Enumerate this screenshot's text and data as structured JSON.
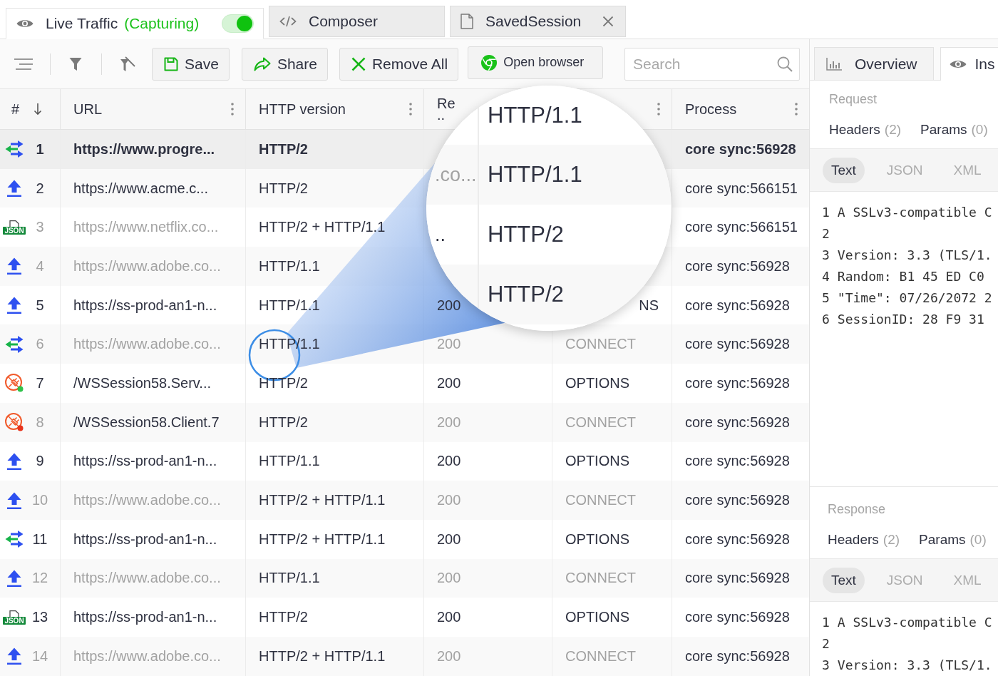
{
  "tabs": [
    {
      "kind": "live",
      "label": "Live Traffic",
      "status": "(Capturing)",
      "capturing": true,
      "closable": false,
      "selected": true
    },
    {
      "kind": "composer",
      "label": "Composer",
      "closable": false,
      "selected": false
    },
    {
      "kind": "session",
      "label": "SavedSession",
      "closable": true,
      "selected": false
    }
  ],
  "toolbar": {
    "buttons": [
      {
        "kind": "save",
        "label": "Save"
      },
      {
        "kind": "share",
        "label": "Share"
      },
      {
        "kind": "remove",
        "label": "Remove All"
      },
      {
        "kind": "browser",
        "label": "Open browser"
      }
    ],
    "search": {
      "placeholder": "Search"
    }
  },
  "table": {
    "columns": [
      {
        "label": "#",
        "sorted": true,
        "menu": false
      },
      {
        "label": "URL",
        "sorted": false,
        "menu": true
      },
      {
        "label": "HTTP version",
        "sorted": false,
        "menu": true
      },
      {
        "label": "Re..",
        "sorted": false,
        "menu": false
      },
      {
        "sorted": false,
        "menu": true
      },
      {
        "label": "Process",
        "sorted": false,
        "menu": true
      }
    ],
    "rows": [
      {
        "kind": "two-way",
        "number": "1",
        "url": "https://www.progre...",
        "version": "HTTP/2",
        "process": "core sync:56928",
        "muted": false,
        "url_muted": false,
        "selected": true
      },
      {
        "kind": "upload",
        "number": "2",
        "url": "https://www.acme.c...",
        "version": "HTTP/2",
        "process": "core sync:566151",
        "muted": false,
        "url_muted": false,
        "selected": false
      },
      {
        "kind": "json",
        "badge": "JSON",
        "number": "3",
        "url": "https://www.netflix.co...",
        "version": "HTTP/2 + HTTP/1.1",
        "process": "core sync:566151",
        "muted": true,
        "url_muted": true,
        "selected": false
      },
      {
        "kind": "upload",
        "number": "4",
        "url": "https://www.adobe.co...",
        "version": "HTTP/1.1",
        "process": "core sync:56928",
        "muted": true,
        "url_muted": true,
        "selected": false
      },
      {
        "kind": "upload",
        "number": "5",
        "url": "https://ss-prod-an1-n...",
        "version": "HTTP/1.1",
        "result": "200",
        "method": "NS",
        "method_cut": true,
        "process": "core sync:56928",
        "muted": false,
        "url_muted": false,
        "selected": false
      },
      {
        "kind": "two-way",
        "number": "6",
        "url": "https://www.adobe.co...",
        "version": "HTTP/1.1",
        "result": "200",
        "method": "CONNECT",
        "process": "core sync:56928",
        "muted": true,
        "url_muted": true,
        "selected": false
      },
      {
        "kind": "plug",
        "color": "#2ec24a",
        "number": "7",
        "url": "/WSSession58.Serv...",
        "version": "HTTP/2",
        "result": "200",
        "method": "OPTIONS",
        "process": "core sync:56928",
        "muted": false,
        "url_muted": false,
        "selected": false
      },
      {
        "kind": "plug",
        "color": "#e8341c",
        "number": "8",
        "url": "/WSSession58.Client.7",
        "version": "HTTP/2",
        "result": "200",
        "method": "CONNECT",
        "process": "core sync:56928",
        "muted": true,
        "url_muted": false,
        "selected": false
      },
      {
        "kind": "upload",
        "number": "9",
        "url": "https://ss-prod-an1-n...",
        "version": "HTTP/1.1",
        "result": "200",
        "method": "OPTIONS",
        "process": "core sync:56928",
        "muted": false,
        "url_muted": false,
        "selected": false
      },
      {
        "kind": "upload",
        "number": "10",
        "url": "https://www.adobe.co...",
        "version": "HTTP/2 + HTTP/1.1",
        "result": "200",
        "method": "CONNECT",
        "process": "core sync:56928",
        "muted": true,
        "url_muted": true,
        "selected": false
      },
      {
        "kind": "two-way",
        "number": "11",
        "url": "https://ss-prod-an1-n...",
        "version": "HTTP/2 + HTTP/1.1",
        "result": "200",
        "method": "OPTIONS",
        "process": "core sync:56928",
        "muted": false,
        "url_muted": false,
        "selected": false
      },
      {
        "kind": "upload",
        "number": "12",
        "url": "https://www.adobe.co...",
        "version": "HTTP/1.1",
        "result": "200",
        "method": "CONNECT",
        "process": "core sync:56928",
        "muted": true,
        "url_muted": true,
        "selected": false
      },
      {
        "kind": "json",
        "badge": "JSON",
        "number": "13",
        "url": "https://ss-prod-an1-n...",
        "version": "HTTP/2",
        "result": "200",
        "method": "OPTIONS",
        "process": "core sync:56928",
        "muted": false,
        "url_muted": false,
        "selected": false
      },
      {
        "kind": "upload",
        "number": "14",
        "url": "https://www.adobe.co...",
        "version": "HTTP/2 + HTTP/1.1",
        "result": "200",
        "method": "CONNECT",
        "process": "core sync:56928",
        "muted": true,
        "url_muted": true,
        "selected": false
      }
    ]
  },
  "magnifier": {
    "rows": [
      {
        "version": "HTTP/1.1"
      },
      {
        "url": ".co...",
        "muted": true,
        "version": "HTTP/1.1"
      },
      {
        "url": "..",
        "muted": false,
        "version": "HTTP/2"
      },
      {
        "version": "HTTP/2"
      }
    ]
  },
  "inspector": {
    "tabs": [
      {
        "kind": "overview",
        "label": "Overview",
        "selected": false
      },
      {
        "kind": "inspectors",
        "label": "Ins",
        "selected": true
      }
    ],
    "sections": [
      {
        "title": "Request",
        "tabs": [
          {
            "label": "Headers",
            "count": "(2)"
          },
          {
            "label": "Params",
            "count": "(0)"
          }
        ],
        "formats": [
          {
            "label": "Text",
            "selected": true
          },
          {
            "label": "JSON",
            "selected": false
          },
          {
            "label": "XML",
            "selected": false
          }
        ],
        "lines": [
          {
            "number": "1",
            "text": "A SSLv3-compatible C"
          },
          {
            "number": "2"
          },
          {
            "number": "3",
            "text": "Version: 3.3 (TLS/1."
          },
          {
            "number": "4",
            "text": "Random: B1 45 ED C0"
          },
          {
            "number": "5",
            "text": "\"Time\": 07/26/2072 2"
          },
          {
            "number": "6",
            "text": "SessionID: 28 F9 31"
          }
        ]
      },
      {
        "title": "Response",
        "tabs": [
          {
            "label": "Headers",
            "count": "(2)"
          },
          {
            "label": "Params",
            "count": "(0)"
          }
        ],
        "formats": [
          {
            "label": "Text",
            "selected": true
          },
          {
            "label": "JSON",
            "selected": false
          },
          {
            "label": "XML",
            "selected": false
          }
        ],
        "lines": [
          {
            "number": "1",
            "text": "A SSLv3-compatible C"
          },
          {
            "number": "2"
          },
          {
            "number": "3",
            "text": "Version: 3.3 (TLS/1."
          }
        ]
      }
    ]
  }
}
